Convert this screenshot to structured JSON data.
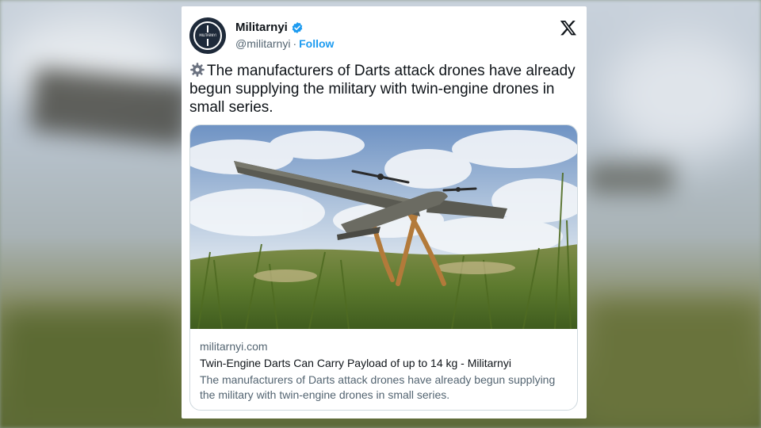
{
  "account": {
    "name": "Militarnyi",
    "handle": "@militarnyi",
    "separator": "·",
    "follow_label": "Follow",
    "avatar_text": "MILITARNYI"
  },
  "tweet": {
    "icon": "gear-icon",
    "text": "The manufacturers of Darts attack drones have already begun supplying the military with twin-engine drones in small series."
  },
  "link_preview": {
    "domain": "militarnyi.com",
    "title": "Twin-Engine Darts Can Carry Payload of up to 14 kg - Militarnyi",
    "description": "The manufacturers of Darts attack drones have already begun supplying the military with twin-engine drones in small series.",
    "image": "drone-on-stand-in-grass-photo"
  },
  "colors": {
    "accent": "#1d9bf0",
    "text_primary": "#0f1419",
    "text_secondary": "#536471",
    "border": "#cfd9de"
  }
}
